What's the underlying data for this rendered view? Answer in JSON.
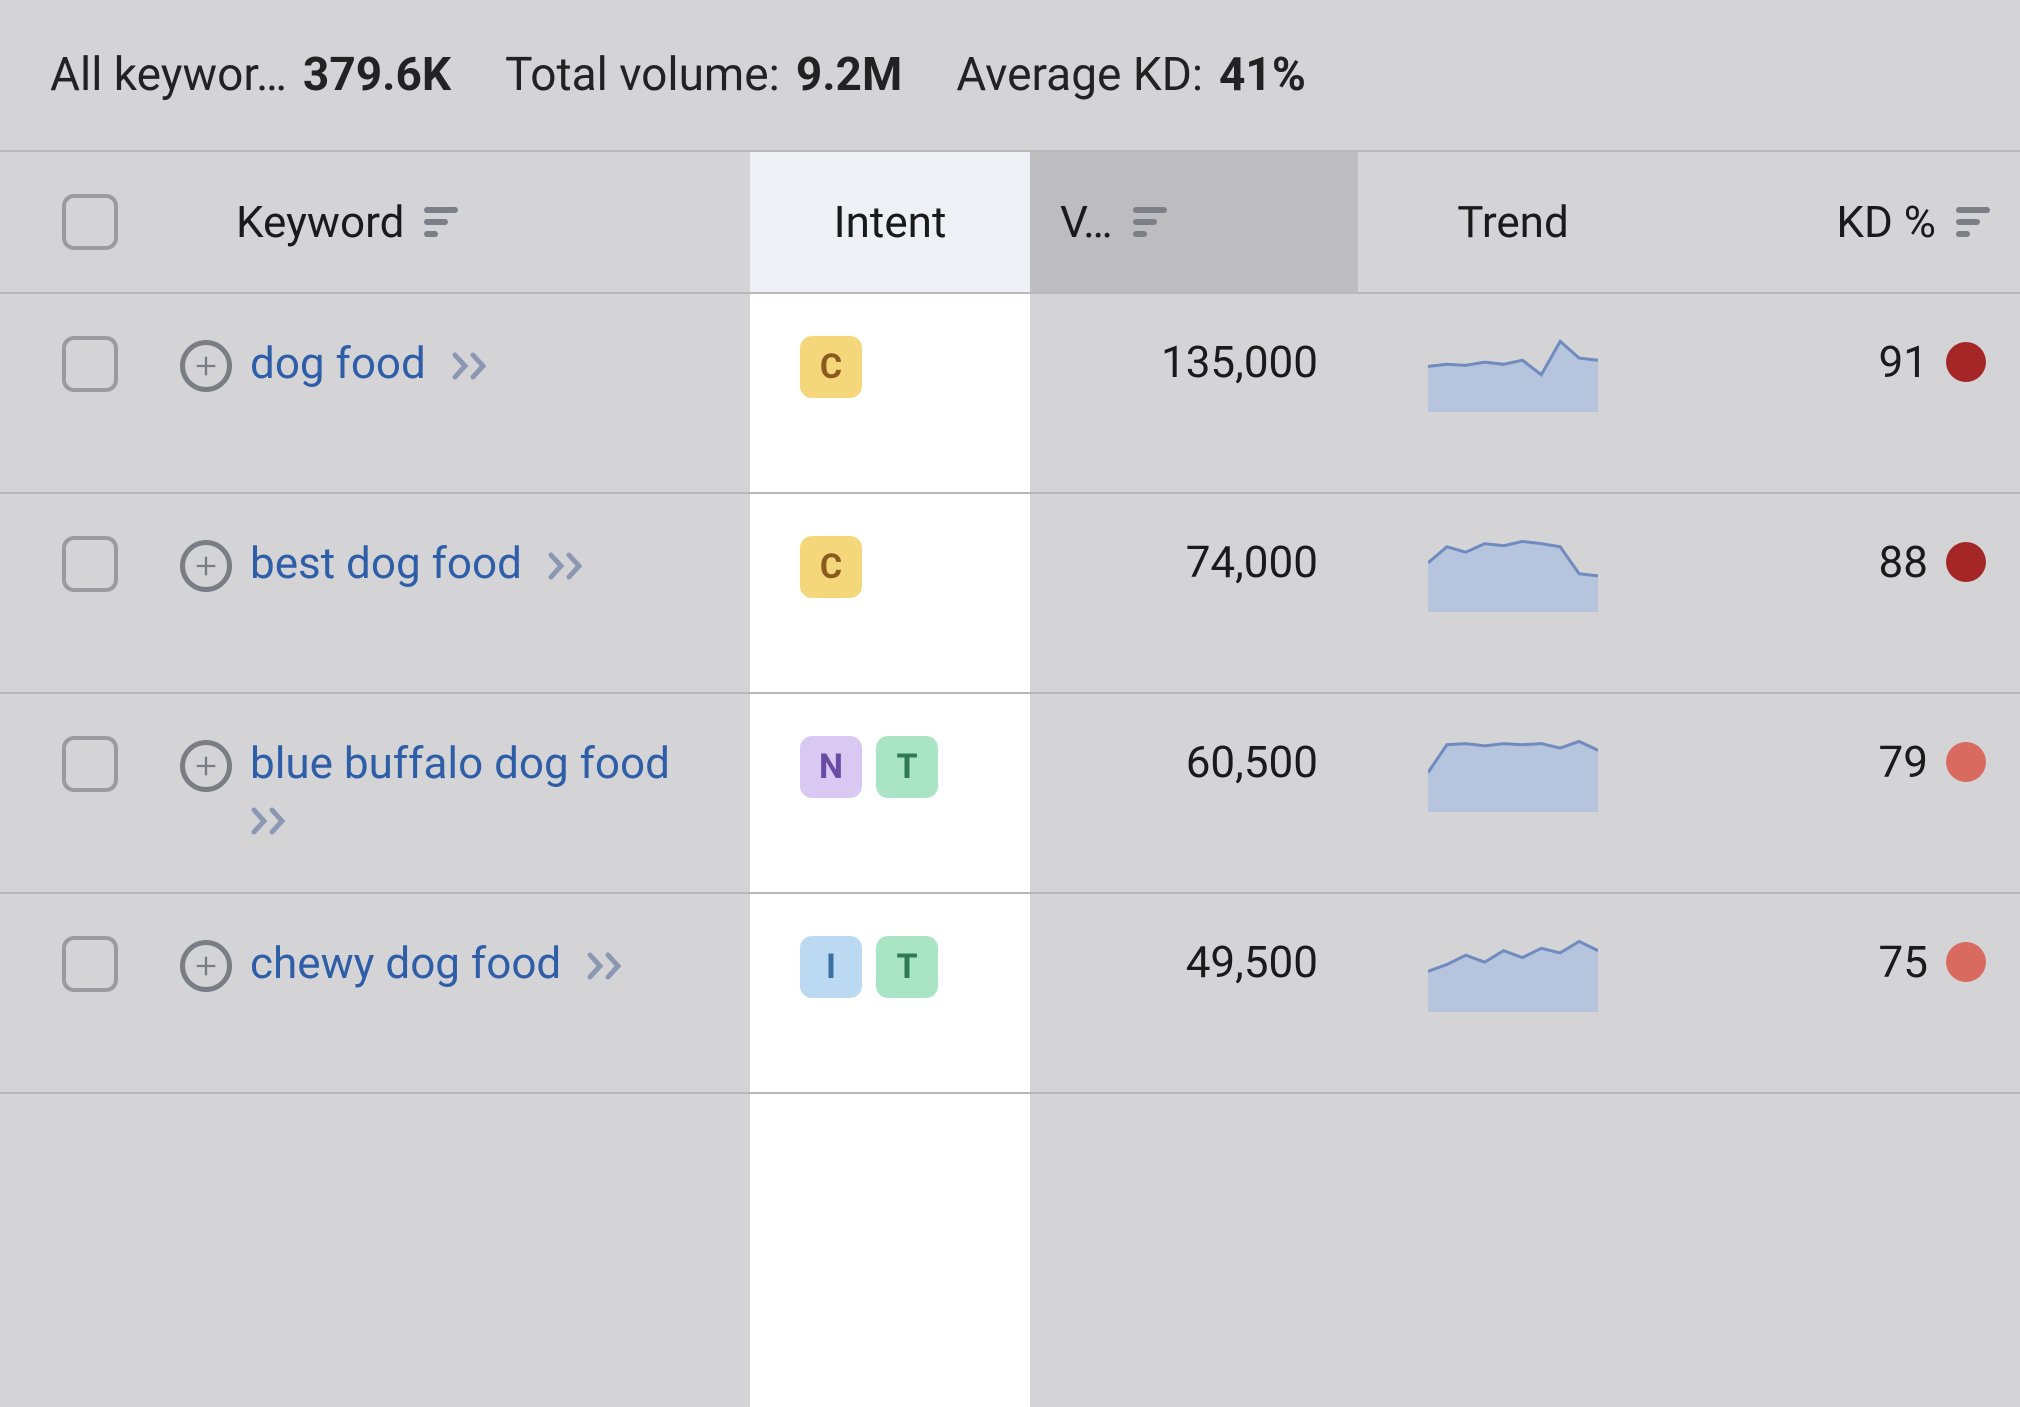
{
  "summary": {
    "all_keywords_label": "All keywor…",
    "all_keywords_value": "379.6K",
    "total_volume_label": "Total volume:",
    "total_volume_value": "9.2M",
    "avg_kd_label": "Average KD:",
    "avg_kd_value": "41%"
  },
  "columns": {
    "keyword": "Keyword",
    "intent": "Intent",
    "volume": "V…",
    "trend": "Trend",
    "kd": "KD %"
  },
  "intent_legend": {
    "C": "Commercial",
    "N": "Navigational",
    "T": "Transactional",
    "I": "Informational"
  },
  "rows": [
    {
      "keyword": "dog food",
      "intents": [
        "C"
      ],
      "volume": "135,000",
      "trend": [
        38,
        40,
        39,
        42,
        40,
        44,
        30,
        62,
        46,
        44
      ],
      "kd": 91,
      "kd_level": "very-hard"
    },
    {
      "keyword": "best dog food",
      "intents": [
        "C"
      ],
      "volume": "74,000",
      "trend": [
        40,
        55,
        50,
        58,
        56,
        60,
        58,
        55,
        30,
        28
      ],
      "kd": 88,
      "kd_level": "very-hard"
    },
    {
      "keyword": "blue buffalo dog food",
      "intents": [
        "N",
        "T"
      ],
      "volume": "60,500",
      "trend": [
        30,
        55,
        56,
        54,
        56,
        55,
        56,
        52,
        58,
        50
      ],
      "kd": 79,
      "kd_level": "hard"
    },
    {
      "keyword": "chewy dog food",
      "intents": [
        "I",
        "T"
      ],
      "volume": "49,500",
      "trend": [
        30,
        36,
        44,
        38,
        48,
        42,
        50,
        46,
        56,
        48
      ],
      "kd": 75,
      "kd_level": "hard"
    }
  ]
}
